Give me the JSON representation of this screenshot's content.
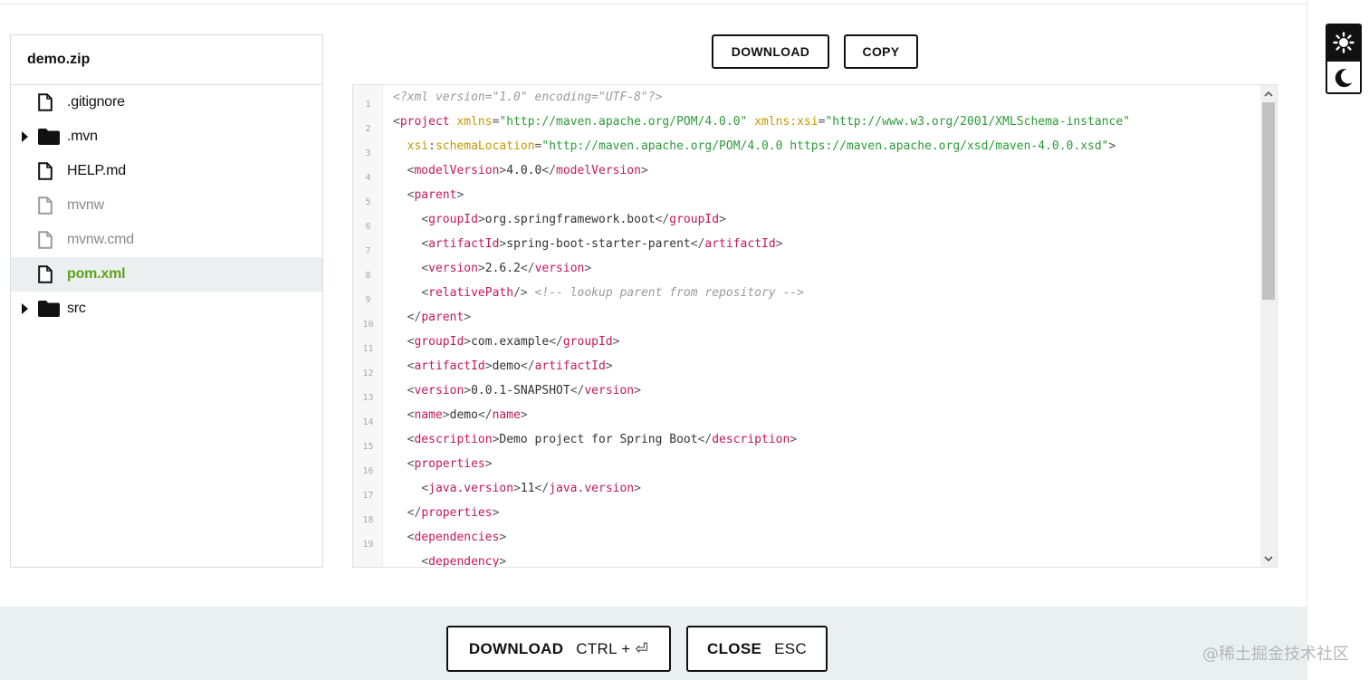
{
  "explorer": {
    "title": "demo.zip",
    "items": [
      {
        "label": ".gitignore",
        "type": "file",
        "state": "normal"
      },
      {
        "label": ".mvn",
        "type": "folder",
        "state": "normal"
      },
      {
        "label": "HELP.md",
        "type": "file",
        "state": "normal"
      },
      {
        "label": "mvnw",
        "type": "file",
        "state": "dim"
      },
      {
        "label": "mvnw.cmd",
        "type": "file",
        "state": "dim"
      },
      {
        "label": "pom.xml",
        "type": "file",
        "state": "selected"
      },
      {
        "label": "src",
        "type": "folder",
        "state": "normal"
      }
    ]
  },
  "toolbar": {
    "download_label": "DOWNLOAD",
    "copy_label": "COPY"
  },
  "editor": {
    "line_numbers": [
      "1",
      "2",
      "3",
      "4",
      "5",
      "6",
      "7",
      "8",
      "9",
      "10",
      "11",
      "12",
      "13",
      "14",
      "15",
      "16",
      "17",
      "18",
      "19"
    ],
    "lines": [
      "<?xml version=\"1.0\" encoding=\"UTF-8\"?>",
      "<project xmlns=\"http://maven.apache.org/POM/4.0.0\" xmlns:xsi=\"http://www.w3.org/2001/XMLSchema-instance\"",
      "  xsi:schemaLocation=\"http://maven.apache.org/POM/4.0.0 https://maven.apache.org/xsd/maven-4.0.0.xsd\">",
      "  <modelVersion>4.0.0</modelVersion>",
      "  <parent>",
      "    <groupId>org.springframework.boot</groupId>",
      "    <artifactId>spring-boot-starter-parent</artifactId>",
      "    <version>2.6.2</version>",
      "    <relativePath/> <!-- lookup parent from repository -->",
      "  </parent>",
      "  <groupId>com.example</groupId>",
      "  <artifactId>demo</artifactId>",
      "  <version>0.0.1-SNAPSHOT</version>",
      "  <name>demo</name>",
      "  <description>Demo project for Spring Boot</description>",
      "  <properties>",
      "    <java.version>11</java.version>",
      "  </properties>",
      "  <dependencies>",
      "    <dependency>"
    ]
  },
  "footer": {
    "download_label": "DOWNLOAD",
    "download_shortcut": "CTRL + ⏎",
    "close_label": "CLOSE",
    "close_shortcut": "ESC"
  },
  "watermark": "@稀土掘金技术社区",
  "icons": {
    "file": "file-icon",
    "folder": "folder-icon",
    "sun": "sun-icon",
    "moon": "moon-icon"
  },
  "colors": {
    "selected_text": "#5fa21c",
    "tag": "#c2185b",
    "attr": "#c29a00",
    "string": "#2e9a3a",
    "comment": "#9a9a9a",
    "footer_bg": "#eaf0f0"
  }
}
